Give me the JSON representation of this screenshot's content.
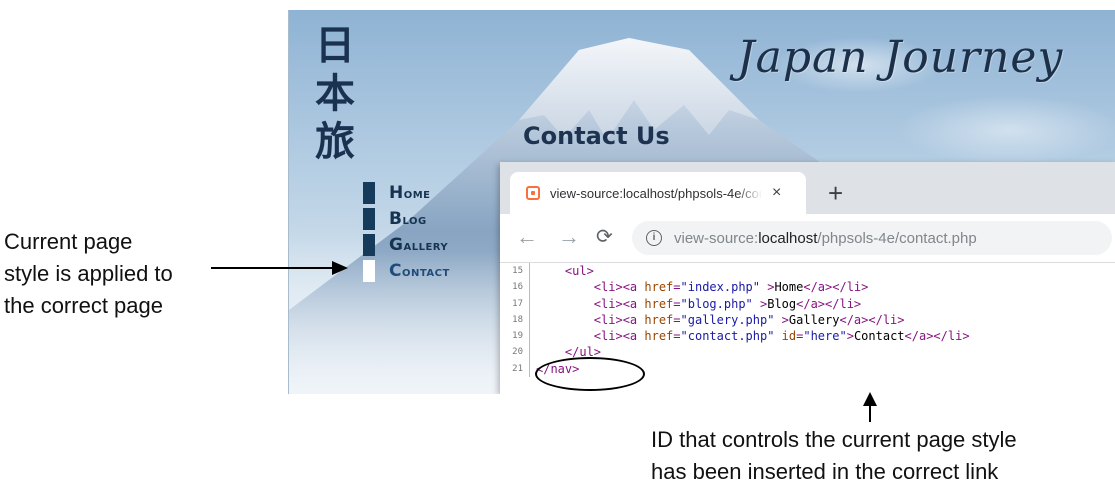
{
  "annotations": {
    "left_callout": [
      "Current page",
      "style is applied to",
      "the correct page"
    ],
    "bottom_callout": [
      "ID that controls the current page style",
      "has been inserted in the correct link"
    ]
  },
  "site": {
    "kanji": [
      "日",
      "本",
      "旅"
    ],
    "title": "Japan Journey",
    "heading": "Contact Us",
    "nav": [
      {
        "label": "Home",
        "current": false
      },
      {
        "label": "Blog",
        "current": false
      },
      {
        "label": "Gallery",
        "current": false
      },
      {
        "label": "Contact",
        "current": true
      }
    ]
  },
  "browser": {
    "tab_title": "view-source:localhost/phpsols-4e/contact.php",
    "tab_close": "×",
    "new_tab": "+",
    "back": "←",
    "forward": "→",
    "reload": "⟳",
    "url_prefix": "view-source:",
    "url_host": "localhost",
    "url_path": "/phpsols-4e/contact.php"
  },
  "source": {
    "line_numbers": [
      "15",
      "16",
      "17",
      "18",
      "19",
      "20",
      "21"
    ],
    "lines": {
      "l15": {
        "indent": "    ",
        "tag": "<ul>"
      },
      "l16": {
        "indent": "        ",
        "open": "<li><a ",
        "attr": "href",
        "eq": "=",
        "val": "\"index.php\"",
        "gt": " >",
        "text": "Home",
        "close": "</a></li>"
      },
      "l17": {
        "indent": "        ",
        "open": "<li><a ",
        "attr": "href",
        "eq": "=",
        "val": "\"blog.php\"",
        "gt": " >",
        "text": "Blog",
        "close": "</a></li>"
      },
      "l18": {
        "indent": "        ",
        "open": "<li><a ",
        "attr": "href",
        "eq": "=",
        "val": "\"gallery.php\"",
        "gt": " >",
        "text": "Gallery",
        "close": "</a></li>"
      },
      "l19": {
        "indent": "        ",
        "open": "<li><a ",
        "attr": "href",
        "eq": "=",
        "val": "\"contact.php\"",
        "sp": " ",
        "attr2": "id",
        "eq2": "=",
        "val2": "\"here\"",
        "gt": ">",
        "text": "Contact",
        "close": "</a></li>"
      },
      "l20": {
        "indent": "    ",
        "tag": "</ul>"
      },
      "l21": {
        "indent": "",
        "tag": "</nav>"
      }
    }
  },
  "colors": {
    "nav_marker": "#163a5a",
    "title": "#1d3049",
    "source_tag": "#881280",
    "source_attr": "#994500",
    "source_value": "#1a1aa6"
  }
}
